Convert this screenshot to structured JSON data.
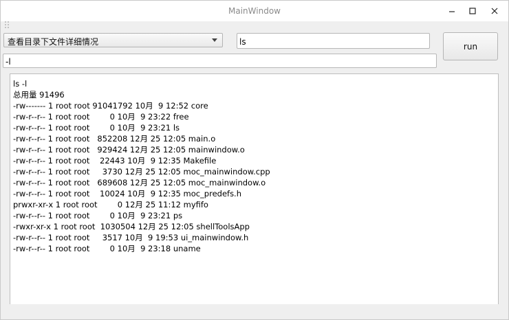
{
  "window": {
    "title": "MainWindow"
  },
  "toolbar": {
    "combo_value": "查看目录下文件详细情况",
    "command_value": "ls",
    "args_value": "-l",
    "run_label": "run"
  },
  "output": {
    "lines": [
      "ls -l",
      "总用量 91496",
      "-rw------- 1 root root 91041792 10月  9 12:52 core",
      "-rw-r--r-- 1 root root        0 10月  9 23:22 free",
      "-rw-r--r-- 1 root root        0 10月  9 23:21 ls",
      "-rw-r--r-- 1 root root   852208 12月 25 12:05 main.o",
      "-rw-r--r-- 1 root root   929424 12月 25 12:05 mainwindow.o",
      "-rw-r--r-- 1 root root    22443 10月  9 12:35 Makefile",
      "-rw-r--r-- 1 root root     3730 12月 25 12:05 moc_mainwindow.cpp",
      "-rw-r--r-- 1 root root   689608 12月 25 12:05 moc_mainwindow.o",
      "-rw-r--r-- 1 root root    10024 10月  9 12:35 moc_predefs.h",
      "prwxr-xr-x 1 root root        0 12月 25 11:12 myfifo",
      "-rw-r--r-- 1 root root        0 10月  9 23:21 ps",
      "-rwxr-xr-x 1 root root  1030504 12月 25 12:05 shellToolsApp",
      "-rw-r--r-- 1 root root     3517 10月  9 19:53 ui_mainwindow.h",
      "-rw-r--r-- 1 root root        0 10月  9 23:18 uname"
    ]
  },
  "icons": {
    "minimize": "minimize-icon",
    "maximize": "maximize-icon",
    "close": "close-icon",
    "combo_arrow": "chevron-down-icon"
  }
}
